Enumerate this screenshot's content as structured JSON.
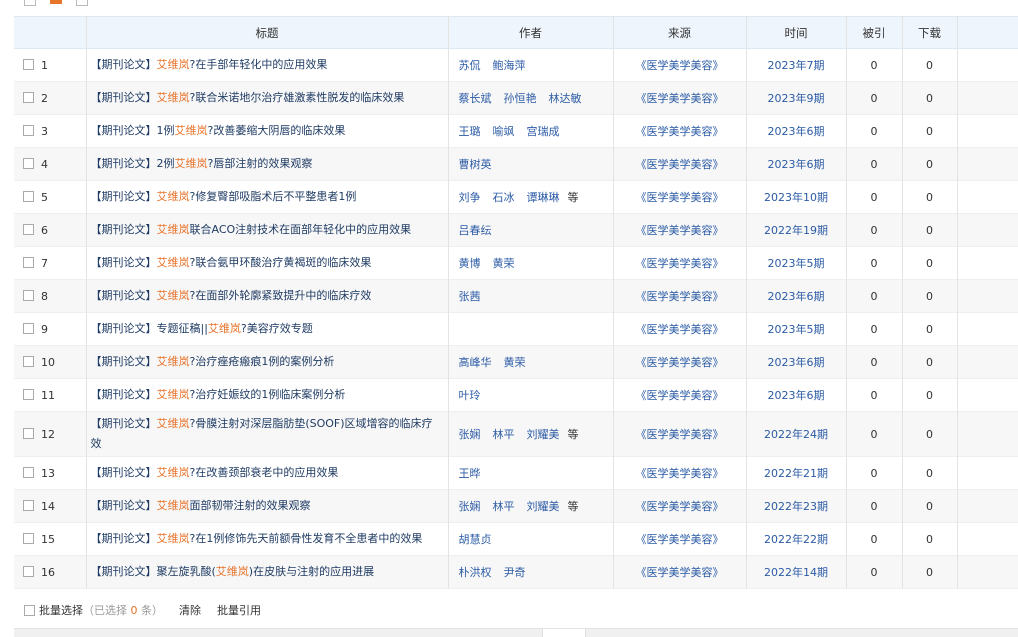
{
  "headers": {
    "title": "标题",
    "author": "作者",
    "source": "来源",
    "time": "时间",
    "cited": "被引",
    "download": "下载"
  },
  "rows": [
    {
      "num": "1",
      "prefix": "【期刊论文】",
      "pre": "",
      "kw": "艾维岚",
      "post": "?在手部年轻化中的应用效果",
      "post2": "",
      "authors": [
        "苏侃",
        "鲍海萍"
      ],
      "etc": "",
      "source": "《医学美学美容》",
      "time": "2023年7期",
      "cited": "0",
      "download": "0"
    },
    {
      "num": "2",
      "prefix": "【期刊论文】",
      "pre": "",
      "kw": "艾维岚",
      "post": "?联合米诺地尔治疗雄激素性脱发的临床效果",
      "post2": "",
      "authors": [
        "蔡长斌",
        "孙恒艳",
        "林达敏"
      ],
      "etc": "",
      "source": "《医学美学美容》",
      "time": "2023年9期",
      "cited": "0",
      "download": "0"
    },
    {
      "num": "3",
      "prefix": "【期刊论文】",
      "pre": "1例",
      "kw": "艾维岚",
      "post": "?改善萎缩大阴唇的临床效果",
      "post2": "",
      "authors": [
        "王璐",
        "喻飒",
        "宫瑞成"
      ],
      "etc": "",
      "source": "《医学美学美容》",
      "time": "2023年6期",
      "cited": "0",
      "download": "0"
    },
    {
      "num": "4",
      "prefix": "【期刊论文】",
      "pre": "2例",
      "kw": "艾维岚",
      "post": "?唇部注射的效果观察",
      "post2": "",
      "authors": [
        "曹树英"
      ],
      "etc": "",
      "source": "《医学美学美容》",
      "time": "2023年6期",
      "cited": "0",
      "download": "0"
    },
    {
      "num": "5",
      "prefix": "【期刊论文】",
      "pre": "",
      "kw": "艾维岚",
      "post": "?修复臀部吸脂术后不平整患者1例",
      "post2": "",
      "authors": [
        "刘争",
        "石冰",
        "谭琳琳"
      ],
      "etc": "等",
      "source": "《医学美学美容》",
      "time": "2023年10期",
      "cited": "0",
      "download": "0"
    },
    {
      "num": "6",
      "prefix": "【期刊论文】",
      "pre": "",
      "kw": "艾维岚",
      "post": "联合ACO注射技术在面部年轻化中的应用效果",
      "post2": "",
      "authors": [
        "吕春纭"
      ],
      "etc": "",
      "source": "《医学美学美容》",
      "time": "2022年19期",
      "cited": "0",
      "download": "0"
    },
    {
      "num": "7",
      "prefix": "【期刊论文】",
      "pre": "",
      "kw": "艾维岚",
      "post": "?联合氨甲环酸治疗黄褐斑的临床效果",
      "post2": "",
      "authors": [
        "黄博",
        "黄荣"
      ],
      "etc": "",
      "source": "《医学美学美容》",
      "time": "2023年5期",
      "cited": "0",
      "download": "0"
    },
    {
      "num": "8",
      "prefix": "【期刊论文】",
      "pre": "",
      "kw": "艾维岚",
      "post": "?在面部外轮廓紧致提升中的临床疗效",
      "post2": "",
      "authors": [
        "张茜"
      ],
      "etc": "",
      "source": "《医学美学美容》",
      "time": "2023年6期",
      "cited": "0",
      "download": "0"
    },
    {
      "num": "9",
      "prefix": "【期刊论文】",
      "pre": "专题征稿||",
      "kw": "艾维岚",
      "post": "?美容疗效专题",
      "post2": "",
      "authors": [],
      "etc": "",
      "source": "《医学美学美容》",
      "time": "2023年5期",
      "cited": "0",
      "download": "0"
    },
    {
      "num": "10",
      "prefix": "【期刊论文】",
      "pre": "",
      "kw": "艾维岚",
      "post": "?治疗痤疮瘢痕1例的案例分析",
      "post2": "",
      "authors": [
        "高峰华",
        "黄荣"
      ],
      "etc": "",
      "source": "《医学美学美容》",
      "time": "2023年6期",
      "cited": "0",
      "download": "0"
    },
    {
      "num": "11",
      "prefix": "【期刊论文】",
      "pre": "",
      "kw": "艾维岚",
      "post": "?治疗妊娠纹的1例临床案例分析",
      "post2": "",
      "authors": [
        "叶玲"
      ],
      "etc": "",
      "source": "《医学美学美容》",
      "time": "2023年6期",
      "cited": "0",
      "download": "0"
    },
    {
      "num": "12",
      "prefix": "【期刊论文】",
      "pre": "",
      "kw": "艾维岚",
      "post": "?骨膜注射对深层脂肪垫(SOOF)区域增容的临床疗",
      "post2": "效",
      "authors": [
        "张娴",
        "林平",
        "刘耀美"
      ],
      "etc": "等",
      "source": "《医学美学美容》",
      "time": "2022年24期",
      "cited": "0",
      "download": "0"
    },
    {
      "num": "13",
      "prefix": "【期刊论文】",
      "pre": "",
      "kw": "艾维岚",
      "post": "?在改善颈部衰老中的应用效果",
      "post2": "",
      "authors": [
        "王晔"
      ],
      "etc": "",
      "source": "《医学美学美容》",
      "time": "2022年21期",
      "cited": "0",
      "download": "0"
    },
    {
      "num": "14",
      "prefix": "【期刊论文】",
      "pre": "",
      "kw": "艾维岚",
      "post": "面部韧带注射的效果观察",
      "post2": "",
      "authors": [
        "张娴",
        "林平",
        "刘耀美"
      ],
      "etc": "等",
      "source": "《医学美学美容》",
      "time": "2022年23期",
      "cited": "0",
      "download": "0"
    },
    {
      "num": "15",
      "prefix": "【期刊论文】",
      "pre": "",
      "kw": "艾维岚",
      "post": "?在1例修饰先天前额骨性发育不全患者中的效果",
      "post2": "",
      "authors": [
        "胡慧贞"
      ],
      "etc": "",
      "source": "《医学美学美容》",
      "time": "2022年22期",
      "cited": "0",
      "download": "0"
    },
    {
      "num": "16",
      "prefix": "【期刊论文】",
      "pre": "聚左旋乳酸(",
      "kw": "艾维岚",
      "post": ")在皮肤与注射的应用进展",
      "post2": "",
      "authors": [
        "朴洪权",
        "尹奇"
      ],
      "etc": "",
      "source": "《医学美学美容》",
      "time": "2022年14期",
      "cited": "0",
      "download": "0"
    }
  ],
  "footer": {
    "batch_select": "批量选择",
    "selected_open": "（已选择",
    "selected_count": "0",
    "selected_close": "条）",
    "clear": "清除",
    "batch_cite": "批量引用"
  }
}
